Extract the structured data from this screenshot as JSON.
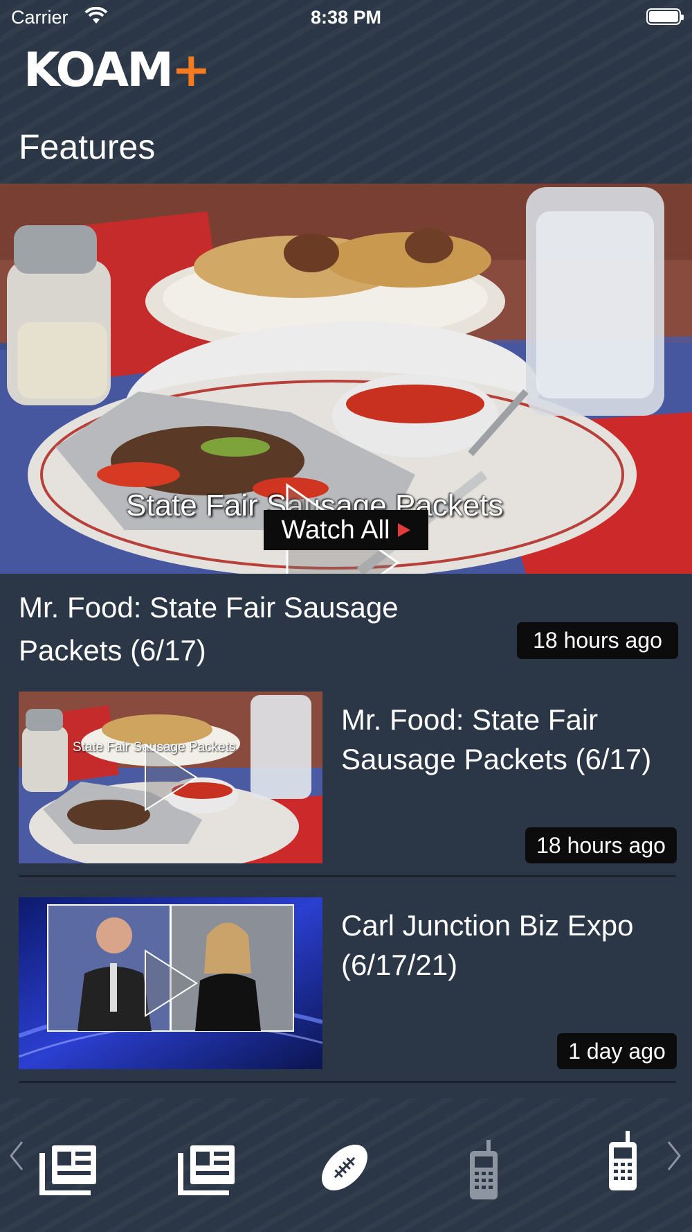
{
  "status_bar": {
    "carrier": "Carrier",
    "time": "8:38 PM"
  },
  "header": {
    "logo_text": "KOAM",
    "logo_plus": "+",
    "section_title": "Features"
  },
  "hero": {
    "caption": "State Fair Sausage Packets",
    "watch_all_label": "Watch All"
  },
  "featured": {
    "title": "Mr. Food: State Fair Sausage Packets (6/17)",
    "time": "18 hours ago"
  },
  "list": [
    {
      "title": "Mr. Food: State Fair Sausage Packets (6/17)",
      "time": "18 hours ago",
      "thumb_caption": "State Fair Sausage Packets"
    },
    {
      "title": "Carl Junction Biz Expo (6/17/21)",
      "time": "1 day ago"
    }
  ],
  "tabbar": {
    "items": [
      {
        "icon": "news-icon",
        "state": "active"
      },
      {
        "icon": "news-icon",
        "state": "active"
      },
      {
        "icon": "football-icon",
        "state": "active"
      },
      {
        "icon": "phone-icon",
        "state": "inactive"
      },
      {
        "icon": "phone-icon",
        "state": "active"
      }
    ]
  },
  "colors": {
    "background": "#2b3646",
    "accent": "#f47b20",
    "badge": "#0c0c0c",
    "play_red": "#e23b3b"
  }
}
